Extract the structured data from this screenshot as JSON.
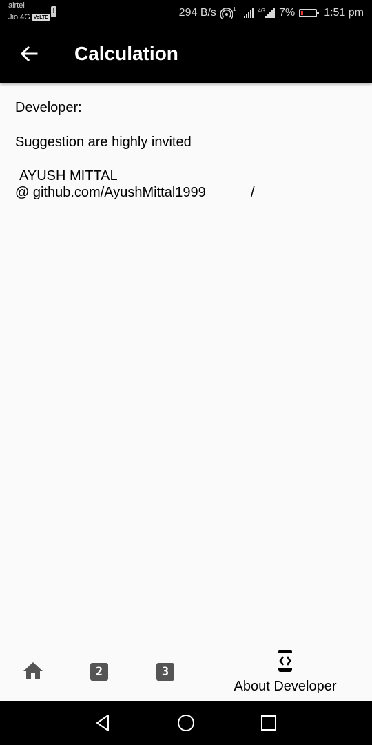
{
  "status_bar": {
    "carrier_1": "airtel",
    "carrier_2": "Jio 4G",
    "volte_badge": "VoLTE",
    "net_speed": "294 B/s",
    "hotspot_count": "1",
    "network_type": "4G",
    "battery_percent": "7%",
    "time": "1:51 pm",
    "battery_level": 0.07
  },
  "app_bar": {
    "title": "Calculation",
    "back_icon": "arrow-left-icon"
  },
  "content": {
    "developer_label": "Developer:",
    "suggestion_text": "Suggestion are highly invited",
    "developer_name": "AYUSH MITTAL",
    "github_text": "@ github.com/AyushMittal1999",
    "trailing_slash": "/"
  },
  "bottom_nav": {
    "items": [
      {
        "icon": "home-icon",
        "label": ""
      },
      {
        "icon": "numbered-box-icon",
        "label": "2"
      },
      {
        "icon": "numbered-box-icon",
        "label": "3"
      },
      {
        "icon": "developer-mode-icon",
        "label": "About Developer",
        "selected": true
      }
    ]
  },
  "system_nav": {
    "back": "triangle-back-icon",
    "home": "circle-home-icon",
    "recents": "square-recents-icon"
  },
  "colors": {
    "app_bar_bg": "#000000",
    "page_bg": "#fafafa",
    "nav_icon": "#555555",
    "battery_low": "#e53935"
  }
}
